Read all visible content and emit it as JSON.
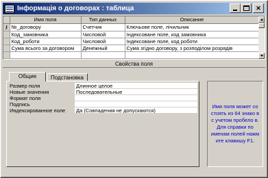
{
  "window": {
    "title": "Інформація о договорах : таблица",
    "icon": "table-icon"
  },
  "grid": {
    "columns": [
      "Имя поля",
      "Тип данных",
      "Описание"
    ],
    "rows": [
      {
        "name": "№_договору",
        "type": "Счетчик",
        "description": "Ключьове поле, лічильник",
        "key": true
      },
      {
        "name": "Код_замовника",
        "type": "Числовой",
        "description": "Індексоване поле, код замовника",
        "key": false
      },
      {
        "name": "Код_роботи",
        "type": "Числовой",
        "description": "Індексоване поле, код роботи",
        "key": false
      },
      {
        "name": "Сума всього за договором",
        "type": "Денежный",
        "description": "Сума згідно договору, з розподілом розрядів",
        "key": false
      },
      {
        "name": "",
        "type": "",
        "description": "",
        "key": false
      },
      {
        "name": "",
        "type": "",
        "description": "",
        "key": false
      }
    ]
  },
  "properties": {
    "section_title": "Свойства поля",
    "tabs": [
      "Общие",
      "Подстановка"
    ],
    "items": [
      {
        "label": "Размер поля",
        "value": "Длинное целое"
      },
      {
        "label": "Новые значения",
        "value": "Последовательные"
      },
      {
        "label": "Формат поля",
        "value": ""
      },
      {
        "label": "Подпись",
        "value": ""
      },
      {
        "label": "Индексированное поле",
        "value": "Да (Совпадения не допускаются)"
      }
    ],
    "help_text": "Имя поля может со стоять из 64 знако в с учетом пробело в.  Для справки по именам полей нажм ите клавишу F1."
  },
  "colors": {
    "title_start": "#0a246a",
    "title_end": "#a6caf0",
    "help_text": "#0000c8",
    "face": "#d4d0c8"
  }
}
